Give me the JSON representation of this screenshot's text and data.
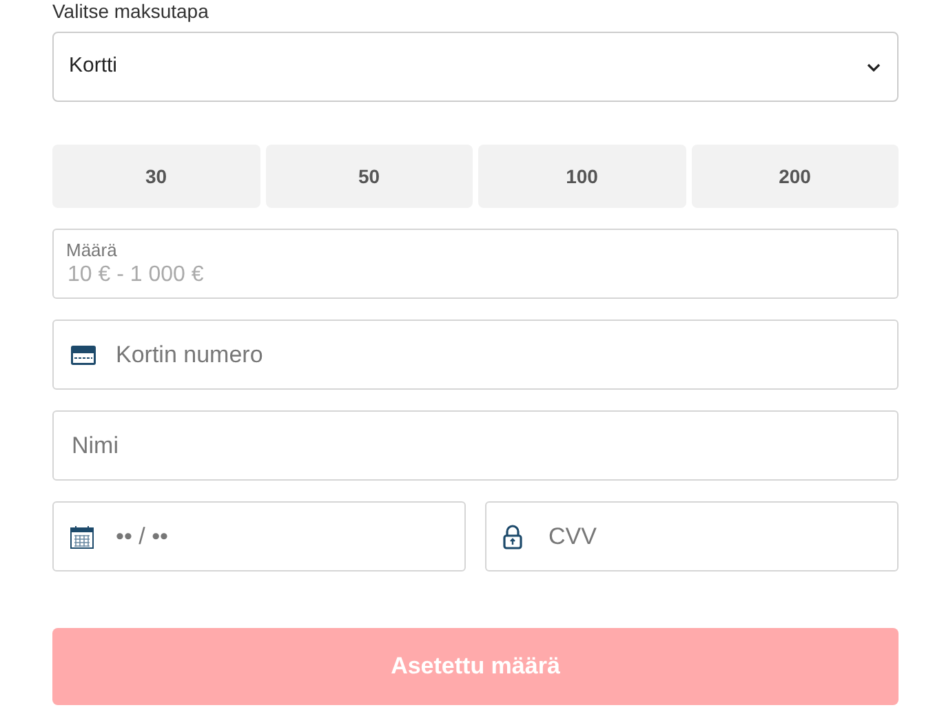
{
  "payment_method": {
    "label": "Valitse maksutapa",
    "value": "Kortti"
  },
  "amount_presets": [
    {
      "label": "30",
      "selected": false
    },
    {
      "label": "50",
      "selected": false
    },
    {
      "label": "100",
      "selected": false
    },
    {
      "label": "200",
      "selected": false
    }
  ],
  "amount": {
    "label": "Määrä",
    "placeholder": "10 € - 1 000 €"
  },
  "card_number": {
    "placeholder": "Kortin numero"
  },
  "name": {
    "placeholder": "Nimi"
  },
  "expiry": {
    "placeholder": "•• / ••"
  },
  "cvv": {
    "placeholder": "CVV"
  },
  "submit": {
    "label": "Asetettu määrä",
    "disabled": true
  }
}
